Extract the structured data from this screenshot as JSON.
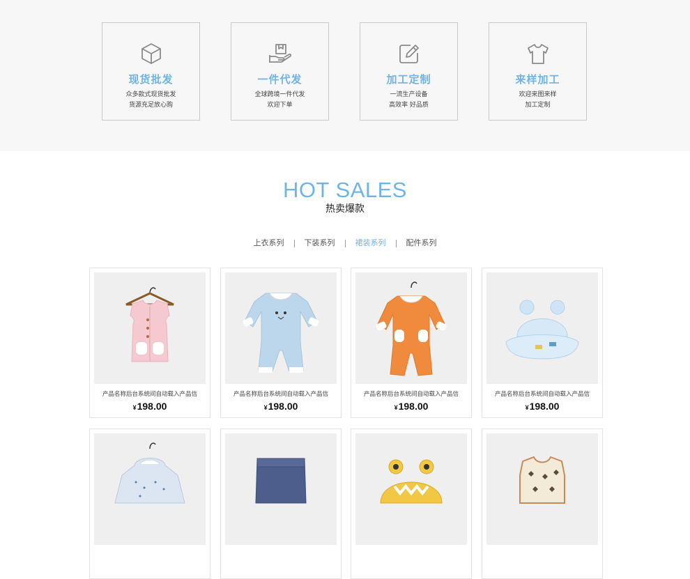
{
  "services": [
    {
      "icon": "box-icon",
      "title": "现货批发",
      "line1": "众多款式现货批发",
      "line2": "货源充足放心购"
    },
    {
      "icon": "hand-package-icon",
      "title": "一件代发",
      "line1": "全球跨境一件代发",
      "line2": "欢迎下单"
    },
    {
      "icon": "edit-icon",
      "title": "加工定制",
      "line1": "一流生产设备",
      "line2": "高效率 好品质"
    },
    {
      "icon": "tshirt-icon",
      "title": "来样加工",
      "line1": "欢迎来图来样",
      "line2": "加工定制"
    }
  ],
  "hot_sales": {
    "title": "HOT SALES",
    "subtitle": "热卖爆款",
    "tabs": [
      "上衣系列",
      "下装系列",
      "裙装系列",
      "配件系列"
    ],
    "active_tab_index": 2
  },
  "products": [
    {
      "name": "产品名称后台系统间自动载入产品信",
      "currency": "¥",
      "price": "198.00",
      "image": "pink-vest"
    },
    {
      "name": "产品名称后台系统间自动载入产品信",
      "currency": "¥",
      "price": "198.00",
      "image": "blue-romper"
    },
    {
      "name": "产品名称后台系统间自动载入产品信",
      "currency": "¥",
      "price": "198.00",
      "image": "orange-romper"
    },
    {
      "name": "产品名称后台系统间自动载入产品信",
      "currency": "¥",
      "price": "198.00",
      "image": "blue-hat"
    },
    {
      "image": "dotted-hoodie"
    },
    {
      "image": "denim-pants"
    },
    {
      "image": "yellow-frog-hat"
    },
    {
      "image": "patterned-vest"
    }
  ],
  "colors": {
    "accent": "#6fb5e4",
    "band_bg": "#f7f7f7",
    "border": "#c9c9c9"
  }
}
